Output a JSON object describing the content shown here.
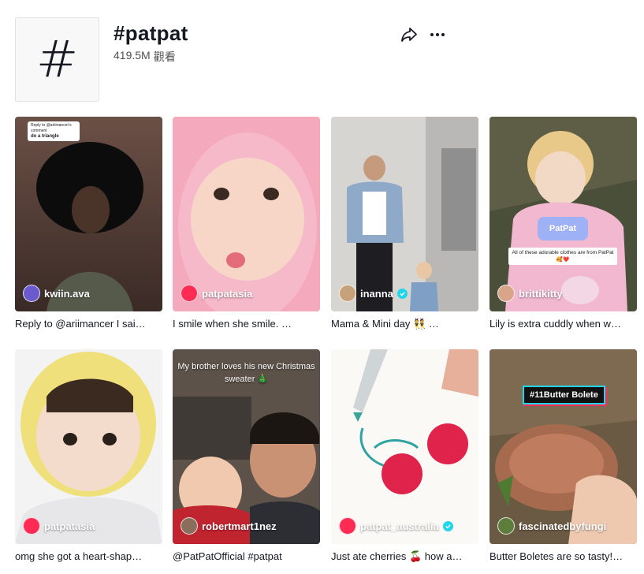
{
  "header": {
    "title": "#patpat",
    "views_count": "419.5M",
    "views_label": "觀看",
    "hash_symbol": "#"
  },
  "icons": {
    "share": "share-arrow-icon",
    "more": "more-options-icon",
    "verified": "verified-check-icon"
  },
  "colors": {
    "text": "#161823",
    "secondary": "#505050",
    "verified": "#20d5ec",
    "brand_red": "#fe2c55"
  },
  "videos": [
    {
      "author": "kwiin.ava",
      "verified": false,
      "caption": "Reply to @ariimancer I sai…",
      "reply_title": "do a triangle",
      "reply_sub": "Reply to @ariimancer's comment"
    },
    {
      "author": "patpatasia",
      "verified": false,
      "caption": "I smile when she smile. …"
    },
    {
      "author": "inanna",
      "verified": true,
      "caption": "Mama & Mini day 👯 …"
    },
    {
      "author": "brittikitty",
      "verified": false,
      "caption": "Lily is extra cuddly when w…",
      "pill": "PatPat",
      "note": "All of these adorable clothes are from PatPat 🥰❤️"
    },
    {
      "author": "patpatasia",
      "verified": false,
      "caption": "omg she got a heart-shap…"
    },
    {
      "author": "robertmart1nez",
      "verified": false,
      "caption": "@PatPatOfficial #patpat",
      "overlay": "My brother loves his new Christmas sweater 🎄"
    },
    {
      "author": "patpat_australia",
      "verified": true,
      "caption": "Just ate cherries 🍒 how a…"
    },
    {
      "author": "fascinatedbyfungi",
      "verified": false,
      "caption": "Butter Boletes are so tasty!…",
      "badge": "#11Butter Bolete"
    }
  ]
}
